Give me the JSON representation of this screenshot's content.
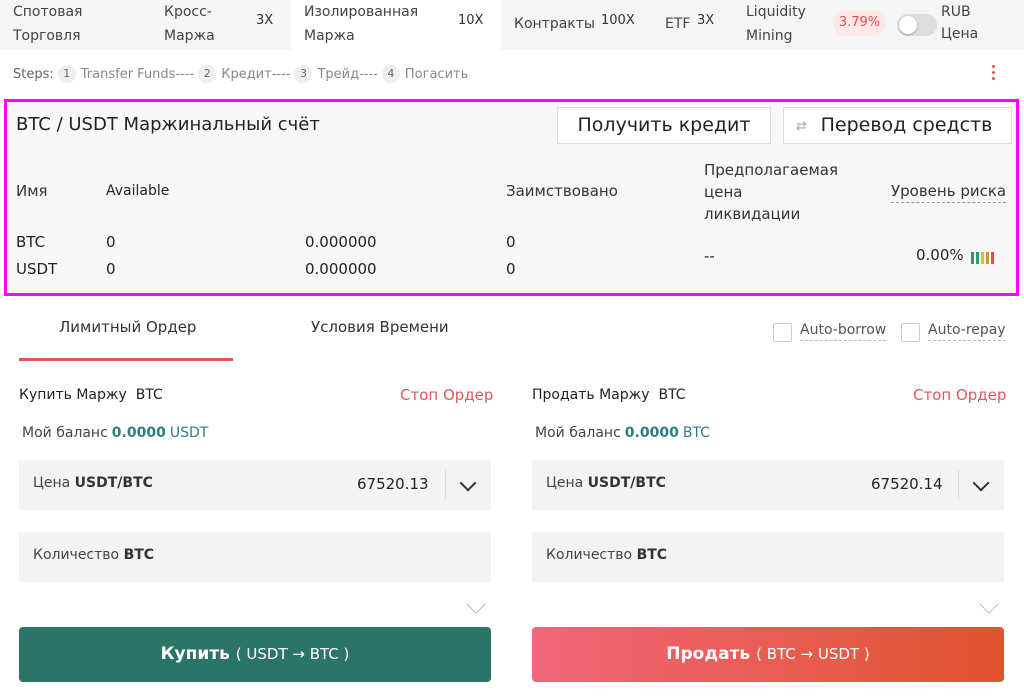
{
  "topbar": {
    "tabs": [
      {
        "line1": "Спотовая",
        "line2": "Торговля",
        "lev": ""
      },
      {
        "line1": "Кросс-",
        "line2": "Маржа",
        "lev": "3X"
      },
      {
        "line1": "Изолированная",
        "line2": "Маржа",
        "lev": "10X"
      },
      {
        "label": "Контракты",
        "lev": "100X"
      },
      {
        "label": "ETF",
        "lev": "3X"
      },
      {
        "line1": "Liquidity",
        "line2": "Mining",
        "lev": ""
      }
    ],
    "badge": "3.79%",
    "rub_line1": "RUB",
    "rub_line2": "Цена"
  },
  "steps": {
    "prefix": "Steps:",
    "items": [
      {
        "num": "1",
        "label": "Transfer Funds----"
      },
      {
        "num": "2",
        "label": "Кредит----"
      },
      {
        "num": "3",
        "label": "Трейд----"
      },
      {
        "num": "4",
        "label": "Погасить"
      }
    ]
  },
  "account": {
    "title": "BTC / USDT Маржинальный счёт",
    "loan_button": "Получить кредит",
    "transfer_button": "Перевод средств",
    "headers": {
      "name": "Имя",
      "available": "Available",
      "borrowed": "Заимствовано",
      "liq1": "Предполагаемая",
      "liq2": "цена",
      "liq3": "ликвидации",
      "risk": "Уровень риска"
    },
    "rows": [
      {
        "name": "BTC",
        "available": "0",
        "amount": "0.000000",
        "borrowed": "0"
      },
      {
        "name": "USDT",
        "available": "0",
        "amount": "0.000000",
        "borrowed": "0"
      }
    ],
    "liquidation": "--",
    "risk_value": "0.00%",
    "risk_colors": [
      "#2d9b6b",
      "#2d9b6b",
      "#e8b63a",
      "#e8883a",
      "#e84e4e"
    ]
  },
  "order": {
    "tab_limit": "Лимитный Ордер",
    "tab_time": "Условия Времени",
    "auto_borrow": "Auto-borrow",
    "auto_repay": "Auto-repay",
    "buy": {
      "title": "Купить Маржу",
      "asset": "BTC",
      "stop": "Стоп Ордер",
      "balance_label": "Мой баланс",
      "balance_value": "0.0000",
      "balance_unit": "USDT",
      "price_label": "Цена",
      "price_unit": "USDT/BTC",
      "price_value": "67520.13",
      "qty_label": "Количество",
      "qty_unit": "BTC",
      "button": "Купить",
      "button_sub": "( USDT → BTC )"
    },
    "sell": {
      "title": "Продать Маржу",
      "asset": "BTC",
      "stop": "Стоп Ордер",
      "balance_label": "Мой баланс",
      "balance_value": "0.0000",
      "balance_unit": "BTC",
      "price_label": "Цена",
      "price_unit": "USDT/BTC",
      "price_value": "67520.14",
      "qty_label": "Количество",
      "qty_unit": "BTC",
      "button": "Продать",
      "button_sub": "( BTC → USDT )"
    }
  }
}
